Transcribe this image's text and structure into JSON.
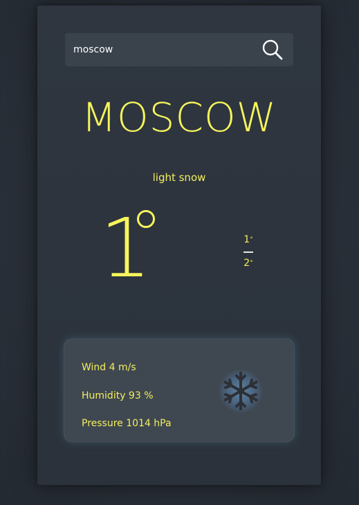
{
  "search": {
    "value": "moscow",
    "placeholder": ""
  },
  "weather": {
    "city": "MOSCOW",
    "description": "light snow",
    "temperature": "1",
    "temp_max": "1",
    "temp_min": "2",
    "icon": "snowflake-icon"
  },
  "details": {
    "wind": "Wind 4 m/s",
    "humidity": "Humidity 93 %",
    "pressure": "Pressure 1014 hPa"
  },
  "colors": {
    "accent": "#f7f55c",
    "card": "#2d343d",
    "panel": "#3f4751",
    "icon": "#2d3036"
  }
}
